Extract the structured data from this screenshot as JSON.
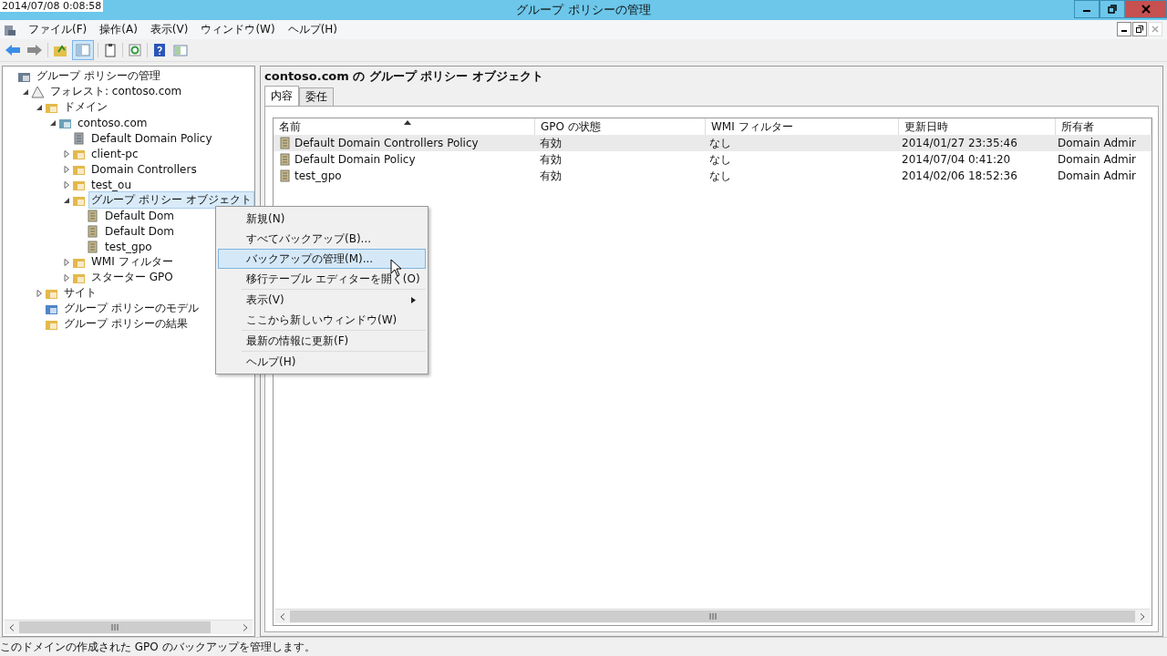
{
  "overlay_time": "2014/07/08 0:08:58",
  "window": {
    "title": "グループ ポリシーの管理"
  },
  "menu": [
    {
      "label": "ファイル(F)"
    },
    {
      "label": "操作(A)"
    },
    {
      "label": "表示(V)"
    },
    {
      "label": "ウィンドウ(W)"
    },
    {
      "label": "ヘルプ(H)"
    }
  ],
  "tree": [
    {
      "label": "グループ ポリシーの管理",
      "kind": "console",
      "selected": false,
      "children": [
        {
          "label": "フォレスト: contoso.com",
          "kind": "forest",
          "expanded": true,
          "selected": false,
          "children": [
            {
              "label": "ドメイン",
              "kind": "folder",
              "expanded": true,
              "selected": false,
              "children": [
                {
                  "label": "contoso.com",
                  "kind": "domain",
                  "expanded": true,
                  "selected": false,
                  "children": [
                    {
                      "label": "Default Domain Policy",
                      "kind": "gpolink",
                      "selected": false
                    },
                    {
                      "label": "client-pc",
                      "kind": "ou",
                      "expanded": false,
                      "selected": false
                    },
                    {
                      "label": "Domain Controllers",
                      "kind": "ou",
                      "expanded": false,
                      "selected": false
                    },
                    {
                      "label": "test_ou",
                      "kind": "ou",
                      "expanded": false,
                      "selected": false
                    },
                    {
                      "label": "グループ ポリシー オブジェクト",
                      "kind": "folder",
                      "expanded": true,
                      "selected": true,
                      "children": [
                        {
                          "label": "Default Dom",
                          "kind": "gpo",
                          "selected": false
                        },
                        {
                          "label": "Default Dom",
                          "kind": "gpo",
                          "selected": false
                        },
                        {
                          "label": "test_gpo",
                          "kind": "gpo",
                          "selected": false
                        }
                      ]
                    },
                    {
                      "label": "WMI フィルター",
                      "kind": "filter",
                      "expanded": false,
                      "selected": false
                    },
                    {
                      "label": "スターター GPO",
                      "kind": "starter",
                      "expanded": false,
                      "selected": false
                    }
                  ]
                }
              ]
            },
            {
              "label": "サイト",
              "kind": "sites",
              "expanded": false,
              "selected": false
            },
            {
              "label": "グループ ポリシーのモデル",
              "kind": "modeling",
              "selected": false
            },
            {
              "label": "グループ ポリシーの結果",
              "kind": "results",
              "selected": false
            }
          ]
        }
      ]
    }
  ],
  "context_menu": {
    "groups": [
      [
        {
          "label": "新規(N)",
          "selected": false,
          "submenu": false
        },
        {
          "label": "すべてバックアップ(B)...",
          "selected": false,
          "submenu": false
        },
        {
          "label": "バックアップの管理(M)...",
          "selected": true,
          "submenu": false
        },
        {
          "label": "移行テーブル エディターを開く(O)",
          "selected": false,
          "submenu": false
        }
      ],
      [
        {
          "label": "表示(V)",
          "selected": false,
          "submenu": true
        },
        {
          "label": "ここから新しいウィンドウ(W)",
          "selected": false,
          "submenu": false
        }
      ],
      [
        {
          "label": "最新の情報に更新(F)",
          "selected": false,
          "submenu": false
        }
      ],
      [
        {
          "label": "ヘルプ(H)",
          "selected": false,
          "submenu": false
        }
      ]
    ]
  },
  "content": {
    "title": "contoso.com の グループ ポリシー オブジェクト",
    "tabs": [
      {
        "label": "内容",
        "selected": true
      },
      {
        "label": "委任",
        "selected": false
      }
    ],
    "table": {
      "columns": [
        {
          "label": "名前",
          "sorted": true
        },
        {
          "label": "GPO の状態",
          "sorted": false
        },
        {
          "label": "WMI フィルター",
          "sorted": false
        },
        {
          "label": "更新日時",
          "sorted": false
        },
        {
          "label": "所有者",
          "sorted": false
        }
      ],
      "rows": [
        {
          "selected": true,
          "cells": [
            "Default Domain Controllers Policy",
            "有効",
            "なし",
            "2014/01/27 23:35:46",
            "Domain Admir"
          ]
        },
        {
          "selected": false,
          "cells": [
            "Default Domain Policy",
            "有効",
            "なし",
            "2014/07/04 0:41:20",
            "Domain Admir"
          ]
        },
        {
          "selected": false,
          "cells": [
            "test_gpo",
            "有効",
            "なし",
            "2014/02/06 18:52:36",
            "Domain Admir"
          ]
        }
      ]
    }
  },
  "status_bar": "このドメインの作成された GPO のバックアップを管理します。"
}
